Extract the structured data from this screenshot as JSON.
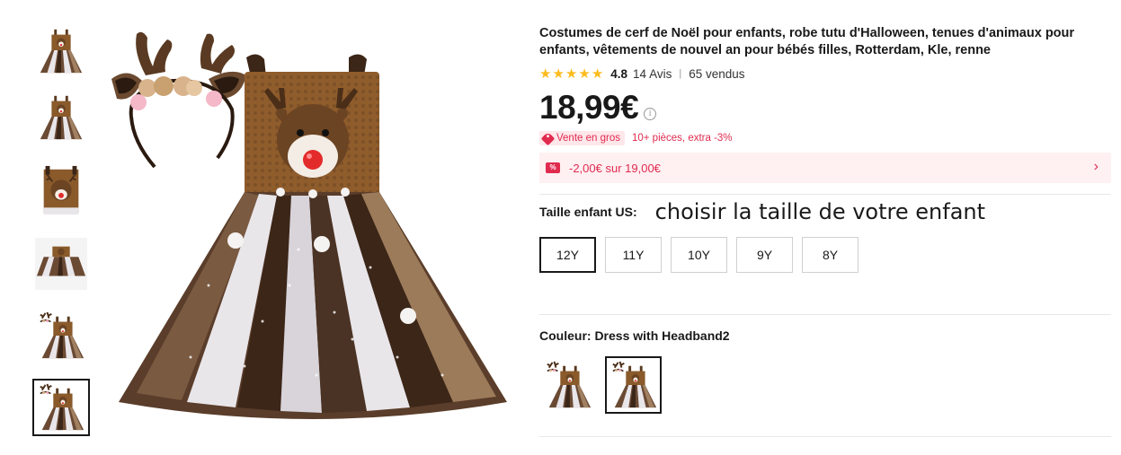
{
  "product": {
    "title": "Costumes de cerf de Noël pour enfants, robe tutu d'Halloween, tenues d'animaux pour enfants, vêtements de nouvel an pour bébés filles, Rotterdam, Kle, renne",
    "rating": {
      "stars": 5,
      "value": "4.8",
      "reviews": "14 Avis",
      "separator": "|",
      "sold": "65 vendus"
    },
    "price": "18,99€",
    "price_info_icon": "info-icon",
    "bulk": {
      "badge_icon": "tag-icon",
      "badge_label": "Vente en gros",
      "text": "10+ pièces, extra -3%"
    },
    "coupon": {
      "icon": "coupon-icon",
      "text": "-2,00€ sur 19,00€",
      "chevron": "›"
    },
    "size": {
      "label": "Taille enfant US:",
      "hint": "choisir la taille de votre enfant",
      "options": [
        "12Y",
        "11Y",
        "10Y",
        "9Y",
        "8Y"
      ],
      "selected": "12Y"
    },
    "color": {
      "label": "Couleur: Dress with Headband2",
      "options": [
        "Dress with Headband",
        "Dress with Headband2"
      ],
      "selected": "Dress with Headband2"
    }
  },
  "gallery": {
    "thumbnail_count": 6,
    "selected_index": 5
  },
  "colors": {
    "star": "#fdbb1d",
    "accent_red": "#e02b4f",
    "coupon_bg": "#fff0f2",
    "dress_brown": "#8a5a2b",
    "tulle_dark": "#4a3324",
    "tulle_light": "#e9e6ea"
  }
}
